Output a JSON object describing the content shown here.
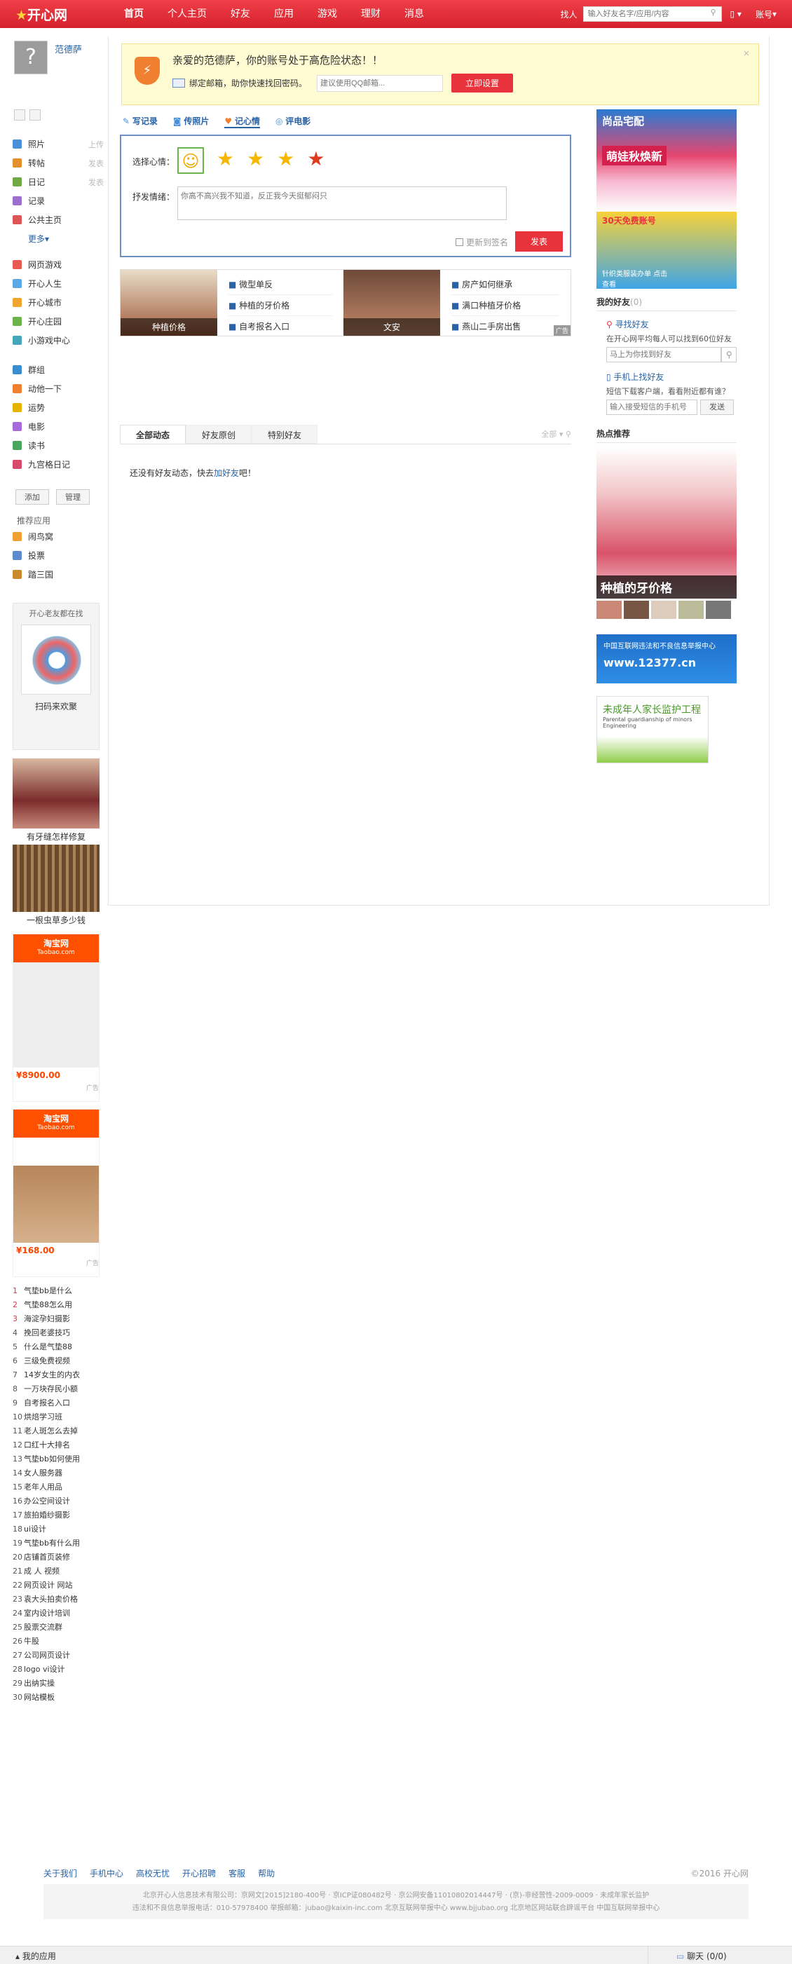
{
  "topbar": {
    "logo": "开心网",
    "nav": [
      "首页",
      "个人主页",
      "好友",
      "应用",
      "游戏",
      "理财",
      "消息"
    ],
    "find_label": "找人",
    "search_placeholder": "输入好友名字/应用/内容",
    "account": "账号"
  },
  "user": {
    "name": "范德萨"
  },
  "left_menu": [
    {
      "label": "照片",
      "sub": "上传",
      "color": "#4a90d9"
    },
    {
      "label": "转帖",
      "sub": "发表",
      "color": "#e38f2c"
    },
    {
      "label": "日记",
      "sub": "发表",
      "color": "#70a843"
    },
    {
      "label": "记录",
      "sub": "",
      "color": "#9c6fcd"
    },
    {
      "label": "公共主页",
      "sub": "",
      "color": "#d55"
    }
  ],
  "left_more": "更多",
  "left_menu2": [
    {
      "label": "网页游戏",
      "color": "#e85a4f"
    },
    {
      "label": "开心人生",
      "color": "#5aa9e6"
    },
    {
      "label": "开心城市",
      "color": "#f0a530"
    },
    {
      "label": "开心庄园",
      "color": "#6bb44b"
    },
    {
      "label": "小游戏中心",
      "color": "#44a6b9"
    }
  ],
  "left_menu3": [
    {
      "label": "群组",
      "color": "#3a8ed0"
    },
    {
      "label": "动他一下",
      "color": "#f08030"
    },
    {
      "label": "运势",
      "color": "#e6b400"
    },
    {
      "label": "电影",
      "color": "#a66ad9"
    },
    {
      "label": "读书",
      "color": "#4aa55e"
    },
    {
      "label": "九宫格日记",
      "color": "#d74a6b"
    }
  ],
  "left_buttons": [
    "添加",
    "管理"
  ],
  "recommend_title": "推荐应用",
  "recommend": [
    {
      "label": "闹鸟窝",
      "color": "#f0a030"
    },
    {
      "label": "投票",
      "color": "#5d8bd0"
    },
    {
      "label": "踏三国",
      "color": "#c98a2b"
    }
  ],
  "qr": {
    "title": "开心老友都在找",
    "caption": "扫码来欢聚"
  },
  "left_ads": {
    "ad1": "有牙缝怎样修复",
    "ad2": "一根虫草多少钱",
    "taobao": "淘宝网",
    "taobao_sub": "Taobao.com",
    "price1": "¥8900.00",
    "price2": "¥168.00",
    "ad_tag": "广告"
  },
  "hot_list": [
    "气垫bb是什么",
    "气垫88怎么用",
    "海淀孕妇摄影",
    "挽回老婆技巧",
    "什么是气垫88",
    "三级免费视频",
    "14岁女生的内衣",
    "一万块存民小额",
    "自考报名入口",
    "烘焙学习班",
    "老人斑怎么去掉",
    "口红十大排名",
    "气垫bb如何使用",
    "女人服务器",
    "老年人用品",
    "办公空间设计",
    "旅拍婚纱摄影",
    "ui设计",
    "气垫bb有什么用",
    "店铺首页装修",
    "成 人 视频",
    "网页设计 网站",
    "袁大头拍卖价格",
    "室内设计培训",
    "股票交流群",
    "牛股",
    "公司网页设计",
    "logo vi设计",
    "出纳实操",
    "网站模板"
  ],
  "alert": {
    "title": "亲爱的范德萨，你的账号处于高危险状态！！",
    "bind": "绑定邮箱，助你快速找回密码。",
    "placeholder": "建议使用QQ邮箱...",
    "button": "立即设置"
  },
  "post_tabs": [
    "写记录",
    "传照片",
    "记心情",
    "评电影"
  ],
  "mood": {
    "label": "选择心情：",
    "detail_label": "抒发情绪：",
    "placeholder": "你高不高兴我不知道，反正我今天挺郁闷只",
    "sync": "更新到签名",
    "submit": "发表"
  },
  "ad_grid": {
    "img1": "种植价格",
    "img2": "文安",
    "links1": [
      "微型单反",
      "种植的牙价格",
      "自考报名入口"
    ],
    "links2": [
      "房产如何继承",
      "满口种植牙价格",
      "燕山二手房出售"
    ],
    "tag": "广告"
  },
  "feed": {
    "tabs": [
      "全部动态",
      "好友原创",
      "特别好友"
    ],
    "filter": "全部",
    "empty": "还没有好友动态，快去",
    "empty_link": "加好友",
    "empty_end": "吧！"
  },
  "right": {
    "banner1": "尚品宅配",
    "banner1_sub": "萌娃秋焕新",
    "banner2": "30天免费账号",
    "banner2_sub": "针织类服装办单 点击查看",
    "friends_title": "我的好友",
    "friends_count": "(0)",
    "find_friend": "寻找好友",
    "find_desc": "在开心网平均每人可以找到60位好友",
    "find_placeholder": "马上为你找到好友",
    "phone": "手机上找好友",
    "phone_desc": "短信下载客户端，看看附近都有谁？",
    "phone_placeholder": "输入接受短信的手机号",
    "send": "发送",
    "hot_title": "热点推荐",
    "hot_caption": "种植的牙价格",
    "report": "中国互联网违法和不良信息举报中心",
    "report_url": "www.12377.cn",
    "minor": "未成年人家长监护工程",
    "minor_en": "Parental guardianship of minors Engineering"
  },
  "footer": {
    "links": [
      "关于我们",
      "手机中心",
      "高校无忧",
      "开心招聘",
      "客服",
      "帮助"
    ],
    "copyright": "©2016 开心网",
    "line1": "北京开心人信息技术有限公司：京网文[2015]2180-400号 · 京ICP证080482号 · 京公网安备11010802014447号 · (京)-非经营性-2009-0009 · 未成年家长监护",
    "line2": "违法和不良信息举报电话：010-57978400 举报邮箱：jubao@kaixin-inc.com  北京互联网举报中心 www.bjjubao.org  北京地区网站联合辟谣平台  中国互联网举报中心"
  },
  "bottom": {
    "apps": "我的应用",
    "chat": "聊天 (0/0)"
  }
}
